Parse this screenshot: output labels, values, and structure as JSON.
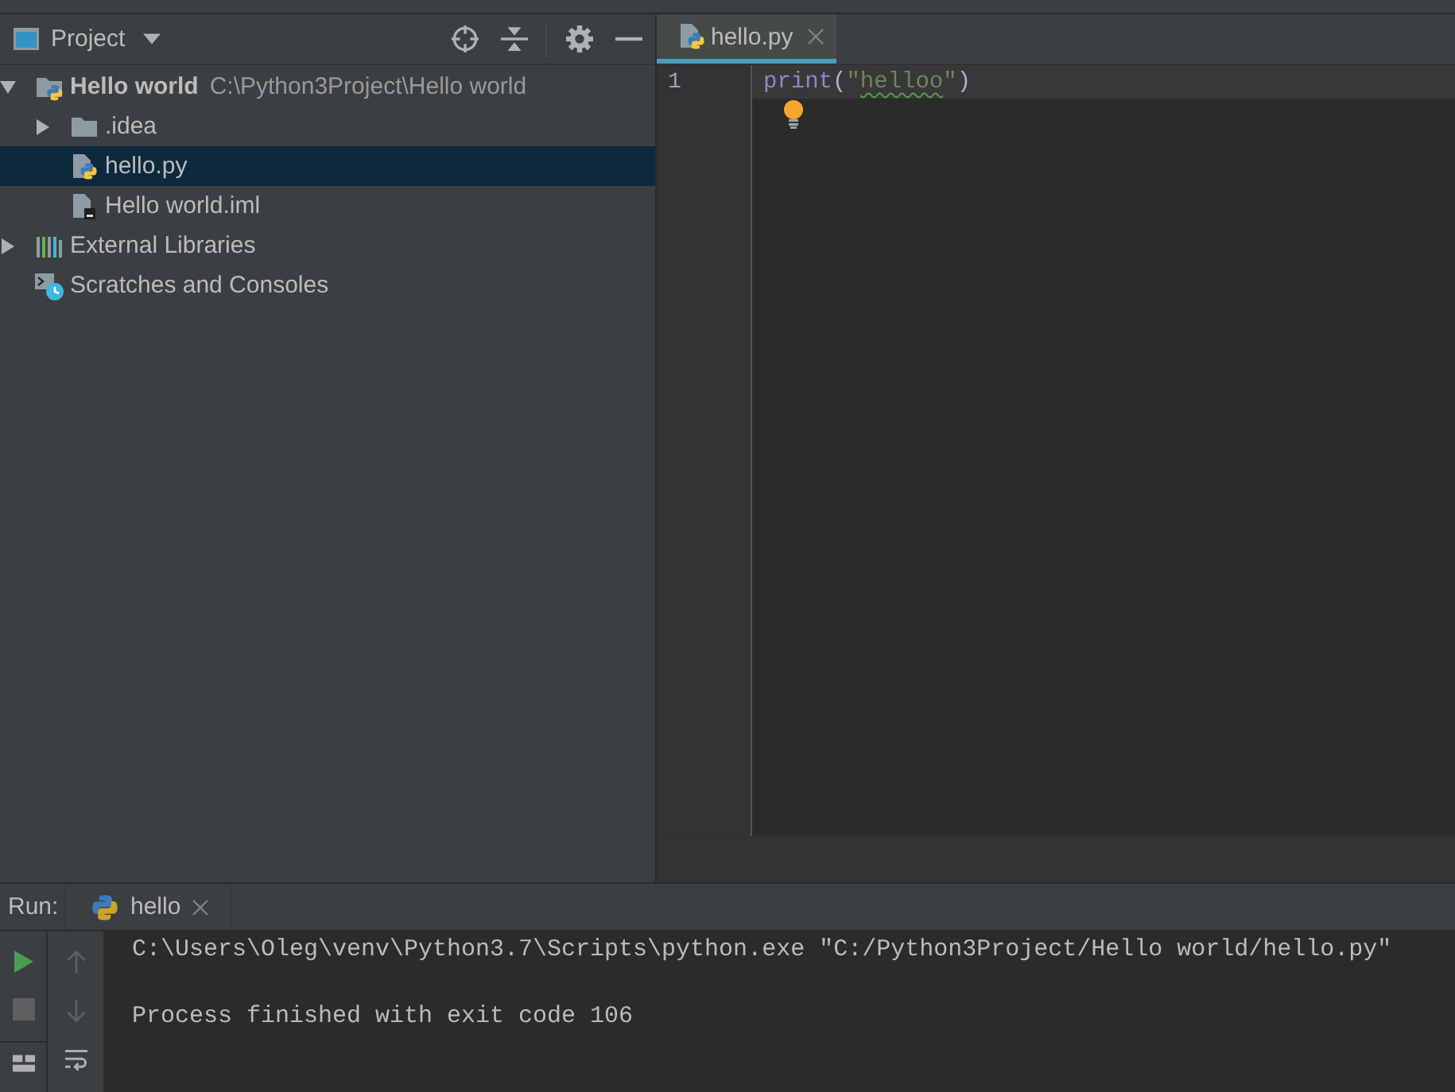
{
  "project_panel": {
    "title": "Project"
  },
  "tree": [
    {
      "kind": "project",
      "label": "Hello world",
      "path": "C:\\Python3Project\\Hello world",
      "expanded": true,
      "selected": false,
      "children": [
        {
          "kind": "folder",
          "label": ".idea",
          "expanded": false,
          "selected": false
        },
        {
          "kind": "python-file",
          "label": "hello.py",
          "selected": true
        },
        {
          "kind": "iml-file",
          "label": "Hello world.iml",
          "selected": false
        }
      ]
    },
    {
      "kind": "libraries",
      "label": "External Libraries",
      "expanded": false,
      "selected": false
    },
    {
      "kind": "scratches",
      "label": "Scratches and Consoles",
      "selected": false
    }
  ],
  "editor": {
    "tabs": [
      {
        "label": "hello.py",
        "selected": true
      }
    ],
    "lines": [
      {
        "number": "1",
        "current": true,
        "tokens": [
          {
            "kind": "builtin",
            "text": "print",
            "typo": false
          },
          {
            "kind": "punct",
            "text": "(",
            "typo": false
          },
          {
            "kind": "string",
            "text": "\"",
            "typo": false
          },
          {
            "kind": "string",
            "text": "helloo",
            "typo": true
          },
          {
            "kind": "string",
            "text": "\"",
            "typo": false
          },
          {
            "kind": "punct",
            "text": ")",
            "typo": false
          }
        ]
      }
    ],
    "intention_bulb": true
  },
  "run_panel": {
    "title": "Run:",
    "tabs": [
      {
        "label": "hello"
      }
    ],
    "run_toolbar": [
      {
        "kind": "rerun",
        "disabled": false
      },
      {
        "kind": "stop",
        "disabled": true
      },
      {
        "kind": "layout",
        "disabled": false
      }
    ],
    "console_toolbar": [
      {
        "kind": "scroll-up",
        "disabled": true
      },
      {
        "kind": "scroll-down",
        "disabled": true
      },
      {
        "kind": "soft-wrap",
        "disabled": false
      }
    ],
    "output": [
      {
        "kind": "command",
        "text": "C:\\Users\\Oleg\\venv\\Python3.7\\Scripts\\python.exe \"C:/Python3Project/Hello world/hello.py\""
      },
      {
        "kind": "exit",
        "text": "Process finished with exit code 106"
      }
    ]
  }
}
